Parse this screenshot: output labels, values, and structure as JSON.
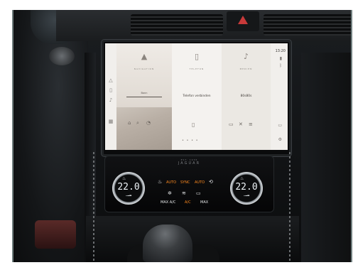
{
  "screen": {
    "time": "13:20",
    "panels": {
      "navigation": {
        "title": "NAVIGATION",
        "field_text": "Bonn",
        "icon": "navigation-arrow-icon"
      },
      "telefon": {
        "title": "TELEFON",
        "action": "Telefon verbinden",
        "icon": "phone-icon"
      },
      "medien": {
        "title": "MEDIEN",
        "source": "80s80s",
        "icon": "music-note-icon"
      }
    },
    "page_dots": "• • • •"
  },
  "climate": {
    "brand_line1": "EST. 1935",
    "brand": "JAGUAR",
    "left_temp": "22.0",
    "right_temp": "22.0",
    "left_mode": "AUTO",
    "right_mode": "AUTO",
    "sync_label": "SYNC",
    "max_ac": "MAX A/C",
    "ac": "A/C",
    "max_defrost": "MAX",
    "colors": {
      "active": "#ff8a1e",
      "temp": "#eef3f7"
    }
  }
}
